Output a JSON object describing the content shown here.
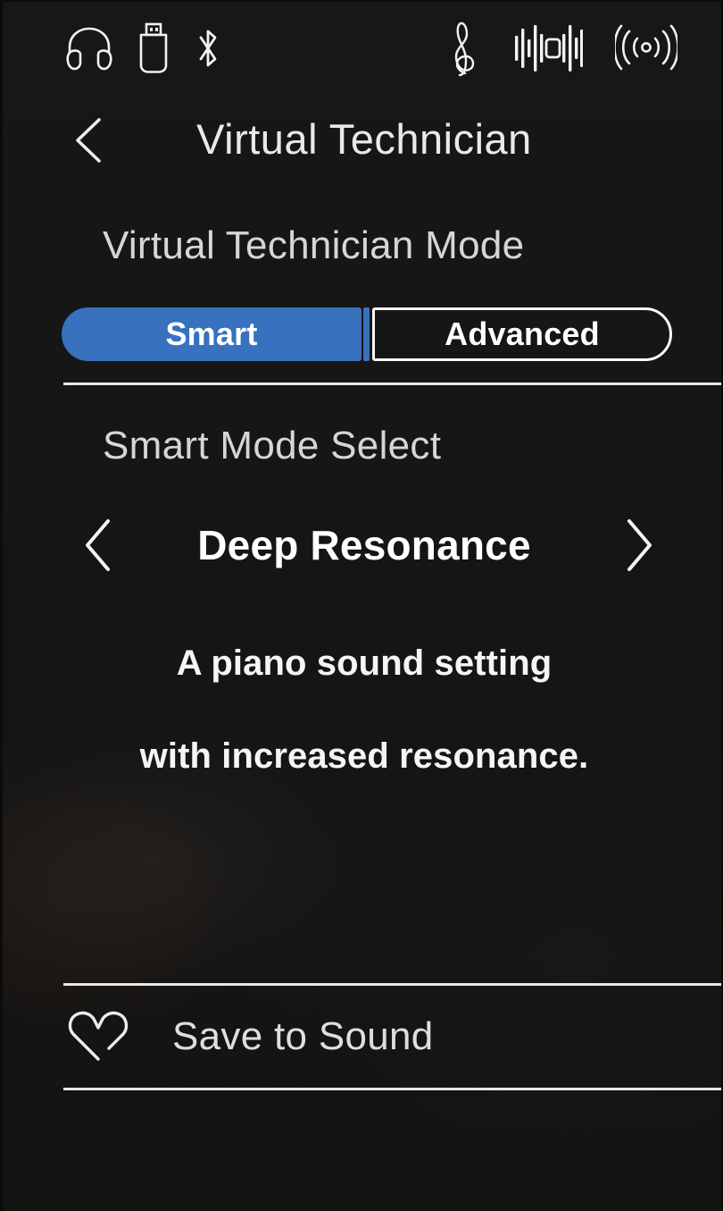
{
  "statusbar": {
    "icons": [
      {
        "name": "headphones-icon",
        "label": "Headphones"
      },
      {
        "name": "usb-drive-icon",
        "label": "USB Drive"
      },
      {
        "name": "bluetooth-icon",
        "label": "Bluetooth"
      },
      {
        "name": "treble-clef-icon",
        "label": "Music / Score"
      },
      {
        "name": "audio-waveform-icon",
        "label": "Audio Recorder"
      },
      {
        "name": "wireless-signal-icon",
        "label": "Wireless"
      }
    ]
  },
  "header": {
    "title": "Virtual Technician",
    "back_label": "Back"
  },
  "mode_section": {
    "label": "Virtual Technician Mode",
    "options": [
      "Smart",
      "Advanced"
    ],
    "selected": "Smart",
    "active_color": "#3871be",
    "inactive_border_color": "#fbfbfb"
  },
  "smart_mode": {
    "label": "Smart Mode Select",
    "prev_label": "Previous",
    "next_label": "Next",
    "value": "Deep Resonance",
    "description_lines": [
      "A piano sound setting",
      "with increased resonance."
    ]
  },
  "save": {
    "label": "Save to Sound",
    "icon": "heart-outline-icon"
  },
  "theme": {
    "background": "#161514",
    "text_primary": "#ffffff",
    "text_secondary": "#d6d6d6",
    "rule_color": "#e7e7e7"
  }
}
